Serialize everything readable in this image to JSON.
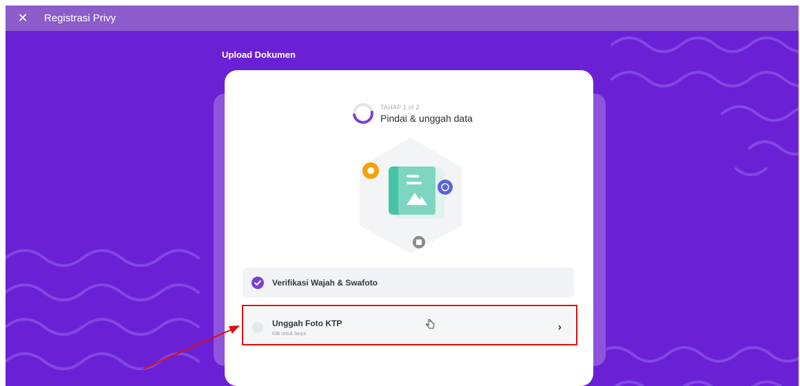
{
  "topbar": {
    "close_icon": "close-icon",
    "close_glyph": "✕",
    "title": "Registrasi Privy"
  },
  "page": {
    "heading": "Upload Dokumen"
  },
  "step": {
    "label": "TAHAP 1 of 2",
    "title": "Pindai & unggah data",
    "progress_fraction": 0.5
  },
  "tasks": [
    {
      "title": "Verifikasi Wajah & Swafoto",
      "status": "done"
    },
    {
      "title": "Unggah Foto KTP",
      "subtitle": "Klik untuk lanjut",
      "status": "pending",
      "chevron": "›"
    }
  ],
  "colors": {
    "background": "#6a21d6",
    "topbar": "#8c5ccb",
    "accent": "#7c3fd6",
    "highlight": "#e00b0b",
    "illustration_teal": "#45c4a6",
    "badge_orange": "#f5a20a",
    "badge_blue": "#5b62e0"
  }
}
